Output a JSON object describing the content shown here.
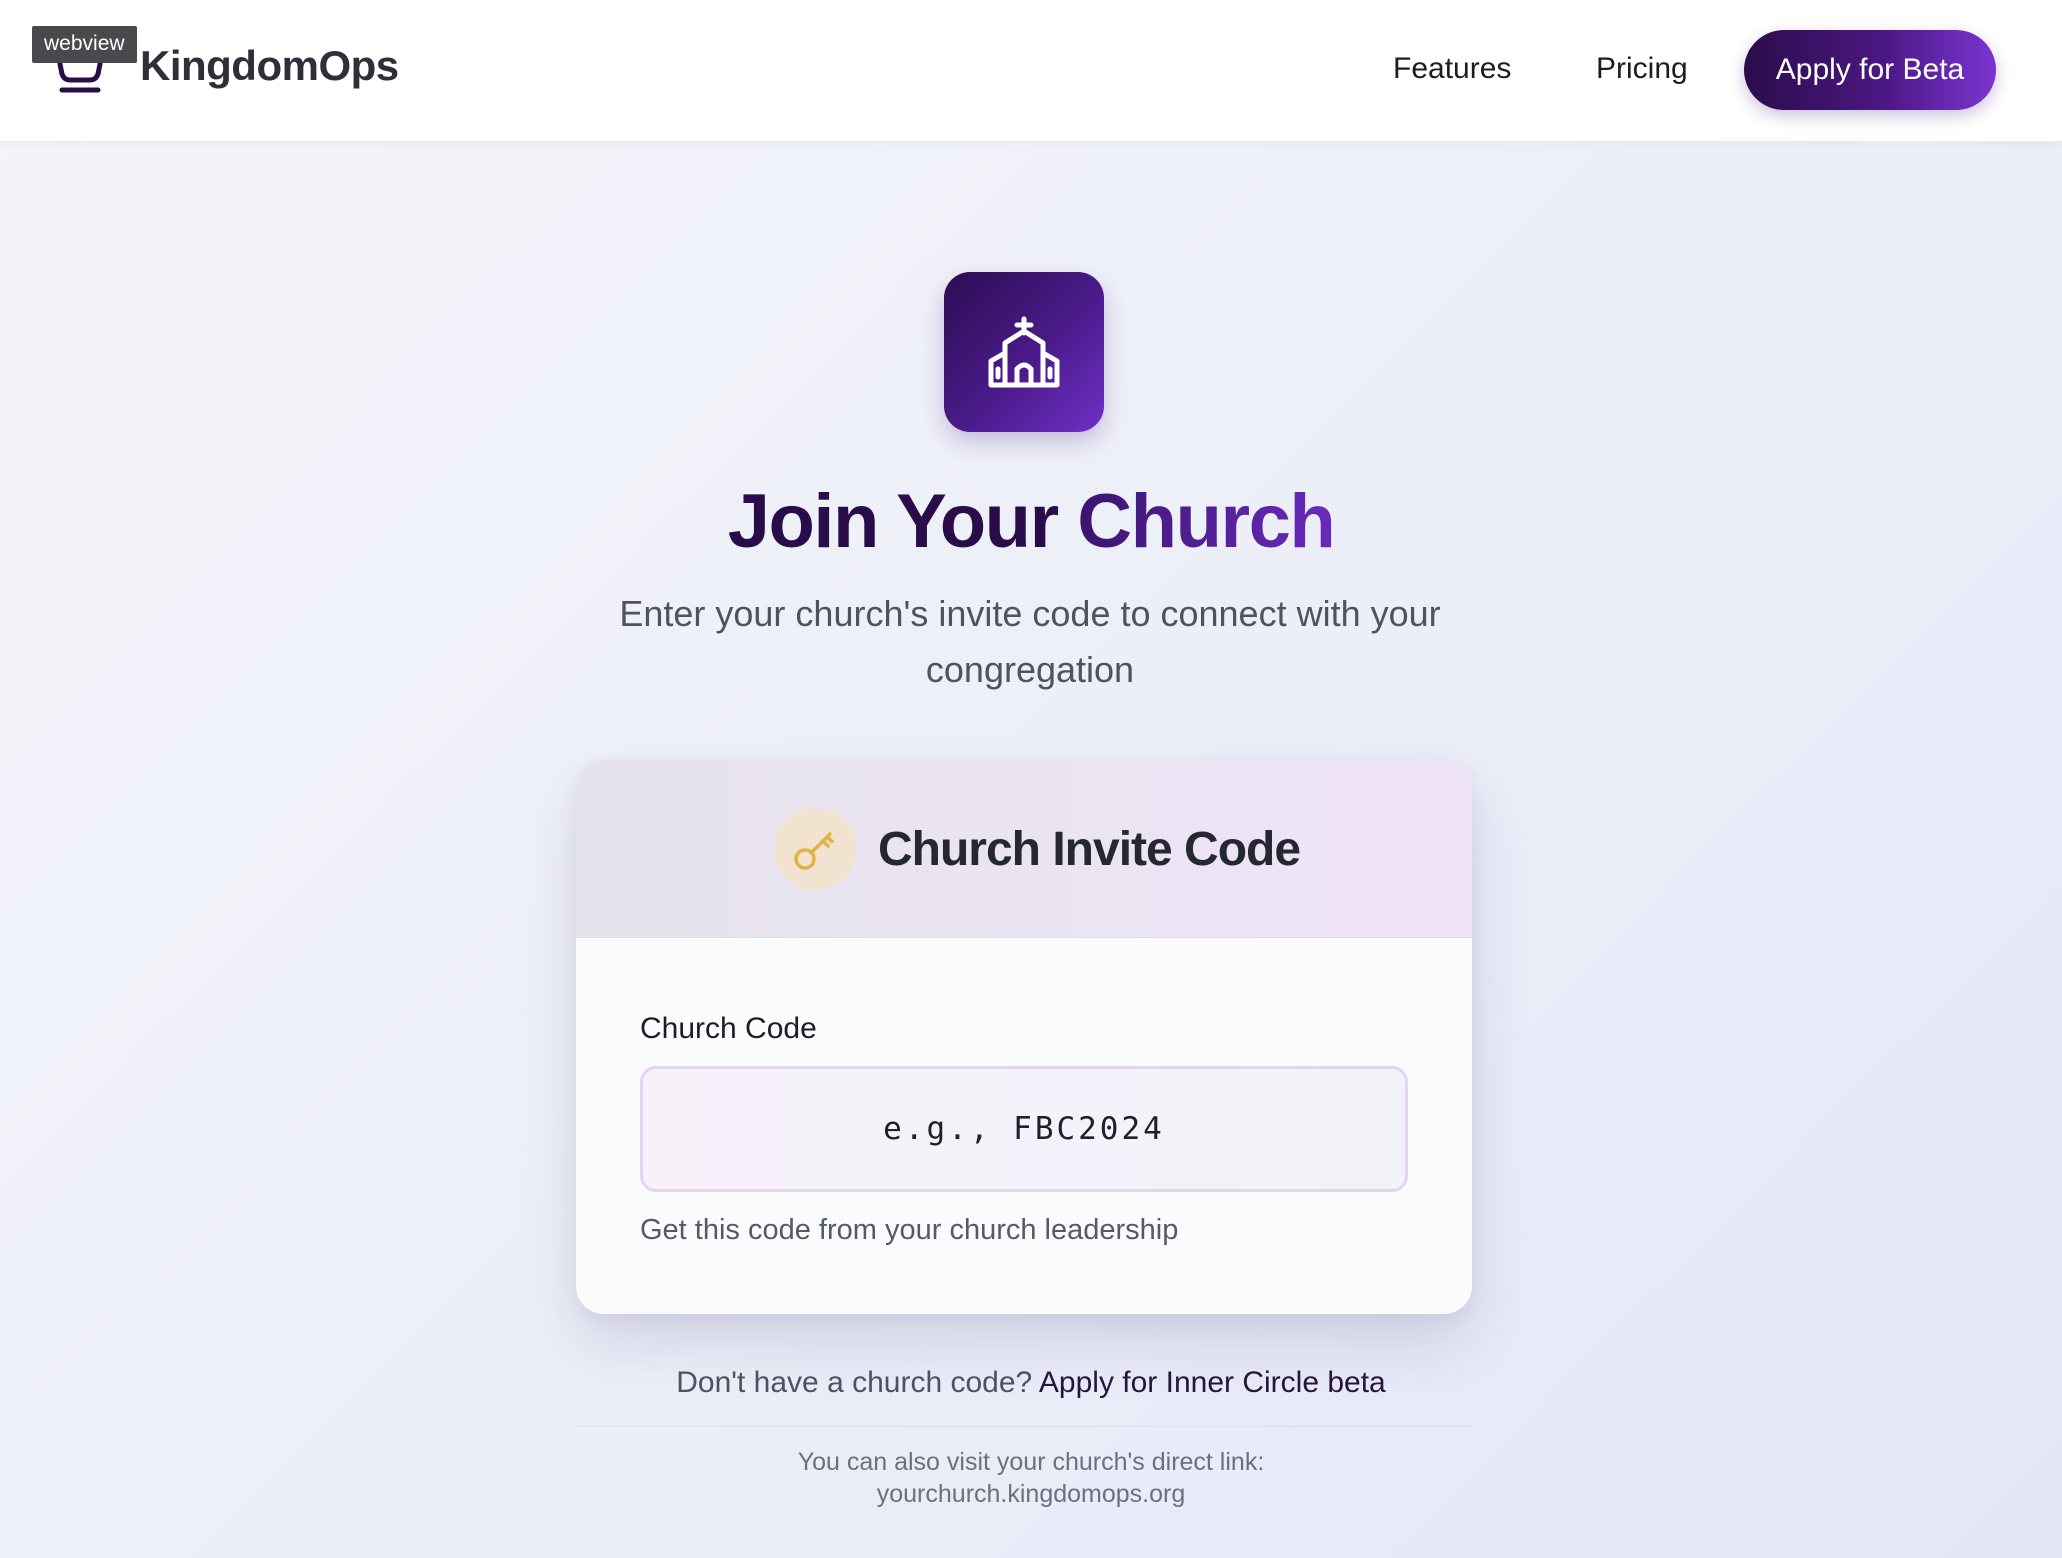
{
  "webview_label": "webview",
  "header": {
    "logo_text": "KingdomOps",
    "nav": {
      "features": "Features",
      "pricing": "Pricing",
      "apply_beta": "Apply for Beta"
    }
  },
  "hero": {
    "icon": "church-icon",
    "title_part1": "Join Your",
    "title_part2": "Church",
    "subtitle": "Enter your church's invite code to connect with your congregation"
  },
  "card": {
    "icon": "key-icon",
    "title": "Church Invite Code",
    "field_label": "Church Code",
    "input_placeholder": "e.g., FBC2024",
    "input_value": "",
    "helper_text": "Get this code from your church leadership"
  },
  "footer": {
    "no_code_text": "Don't have a church code?",
    "no_code_link": "Apply for Inner Circle beta",
    "direct_link_text": "You can also visit your church's direct link:",
    "direct_link_url": "yourchurch.kingdomops.org"
  },
  "colors": {
    "brand_dark": "#2a0c4a",
    "brand_purple": "#6a2bbd",
    "key_gold": "#e0b444"
  }
}
